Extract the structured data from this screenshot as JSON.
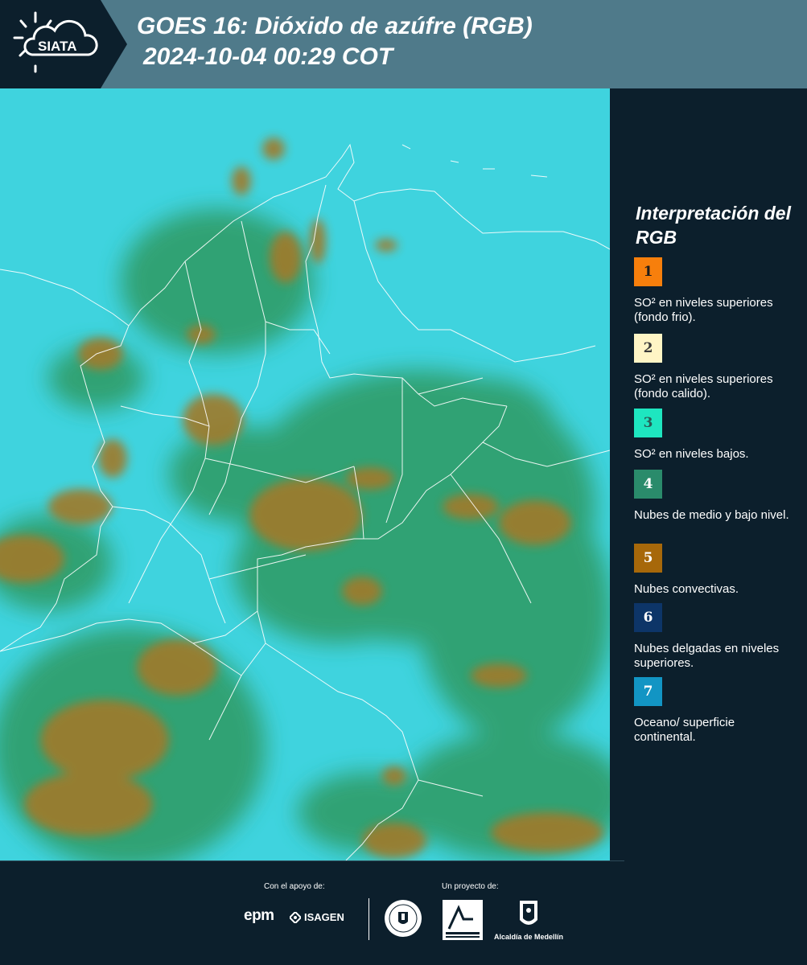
{
  "header": {
    "title_line1": "GOES 16: Dióxido de azúfre (RGB)",
    "title_line2": "2024-10-04 00:29 COT",
    "logo_text": "SIATA"
  },
  "legend": {
    "title": "Interpretación del RGB",
    "items": [
      {
        "number": "1",
        "label": "SO² en niveles superiores (fondo frio).",
        "color": "#f77f0c",
        "text_color": "#1b1b1b"
      },
      {
        "number": "2",
        "label": "SO² en niveles superiores (fondo calido).",
        "color": "#fff5c5",
        "text_color": "#3a3a3a"
      },
      {
        "number": "3",
        "label": "SO² en niveles bajos.",
        "color": "#1ee6c0",
        "text_color": "#2a5a55"
      },
      {
        "number": "4",
        "label": "Nubes de medio y bajo nivel.",
        "color": "#2a8b6b",
        "text_color": "#ffffff"
      },
      {
        "number": "5",
        "label": "Nubes convectivas.",
        "color": "#a7680a",
        "text_color": "#ffffff"
      },
      {
        "number": "6",
        "label": "Nubes delgadas en niveles superiores.",
        "color": "#0d3568",
        "text_color": "#ffffff"
      },
      {
        "number": "7",
        "label": "Oceano/ superficie continental.",
        "color": "#1295c4",
        "text_color": "#ffffff"
      }
    ]
  },
  "footer": {
    "support_label": "Con el apoyo de:",
    "project_label": "Un proyecto de:",
    "sponsor1": "epm",
    "sponsor2": "ISAGEN",
    "partner1": "Área Metropolitana",
    "partner2": "Alcaldía de Medellín"
  },
  "map_colors": {
    "background": "#3fd3de",
    "clouds_mid_low": "#2f9a62",
    "clouds_convective": "#a07a2c",
    "borders": "#ffffff"
  }
}
